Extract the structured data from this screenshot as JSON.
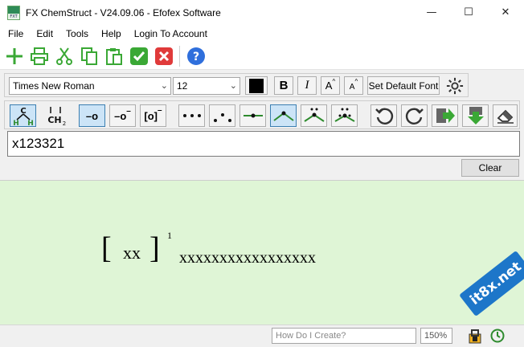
{
  "window": {
    "title": "FX ChemStruct - V24.09.06 - Efofex Software",
    "minimize": "—",
    "maximize": "☐",
    "close": "✕"
  },
  "menu": [
    "File",
    "Edit",
    "Tools",
    "Help",
    "Login To Account"
  ],
  "toolbar1": {
    "icons": [
      "new-icon",
      "print-icon",
      "cut-icon",
      "copy-icon",
      "paste-icon",
      "accept-icon",
      "cancel-icon",
      "help-icon"
    ],
    "colors": {
      "green": "#3aa835",
      "red": "#e03a3a",
      "blue": "#2f6fdc"
    }
  },
  "font_toolbar": {
    "font_family": "Times New Roman",
    "font_size": "12",
    "color_swatch": "#000000",
    "bold_label": "B",
    "italic_label": "I",
    "superscript_label": "A",
    "subscript_label": "A",
    "default_font_label": "Set Default Font"
  },
  "structure_toolbar": {
    "carbon_label": "C",
    "h_label": "H",
    "ch2_label": "CH",
    "ch2_sub": "2",
    "charge_o": "–o",
    "charge_o_minus": "–o",
    "charge_o_minus_sup": "–",
    "bracket_o": "[o]",
    "bracket_o_sup": "–"
  },
  "input": {
    "value": "x123321",
    "clear_label": "Clear"
  },
  "canvas": {
    "bracket_open": "[",
    "bracket_text": "xx",
    "bracket_close": "]",
    "superscript": "1",
    "baseline_text": "xxxxxxxxxxxxxxxxx"
  },
  "status": {
    "howto_placeholder": "How Do I Create?",
    "zoom": "150%",
    "watermark": "it8x.net"
  }
}
